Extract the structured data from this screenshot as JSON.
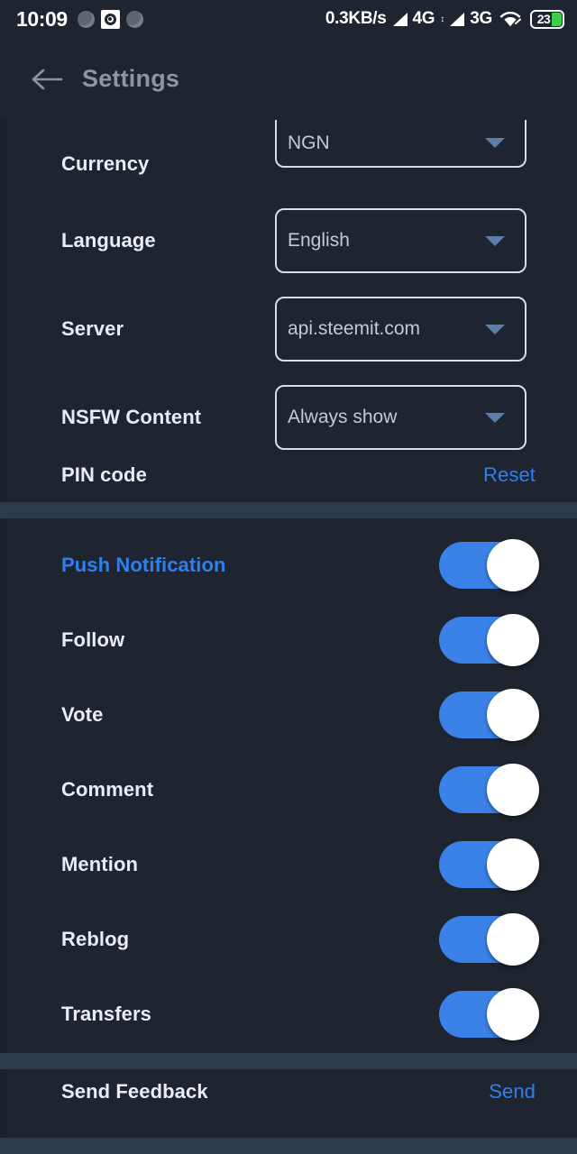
{
  "status_bar": {
    "clock": "10:09",
    "network_speed": "0.3KB/s",
    "network_4g": "4G",
    "network_3g": "3G",
    "updown_glyph": "↕",
    "battery_level": "23",
    "icons": [
      "notification-dot-icon",
      "camera-target-icon",
      "notification-dot-icon",
      "signal-4g-icon",
      "signal-3g-icon",
      "wifi-icon",
      "battery-icon"
    ]
  },
  "header": {
    "back_icon": "arrow-left-icon",
    "title": "Settings"
  },
  "settings": {
    "selects": [
      {
        "label": "Currency",
        "value": "NGN",
        "name": "currency"
      },
      {
        "label": "Language",
        "value": "English",
        "name": "language"
      },
      {
        "label": "Server",
        "value": "api.steemit.com",
        "name": "server"
      },
      {
        "label": "NSFW Content",
        "value": "Always show",
        "name": "nsfw-content"
      }
    ],
    "pin": {
      "label": "PIN code",
      "action": "Reset"
    },
    "toggles": [
      {
        "label": "Push Notification",
        "on": true,
        "accent": true,
        "name": "push-notification"
      },
      {
        "label": "Follow",
        "on": true,
        "accent": false,
        "name": "follow"
      },
      {
        "label": "Vote",
        "on": true,
        "accent": false,
        "name": "vote"
      },
      {
        "label": "Comment",
        "on": true,
        "accent": false,
        "name": "comment"
      },
      {
        "label": "Mention",
        "on": true,
        "accent": false,
        "name": "mention"
      },
      {
        "label": "Reblog",
        "on": true,
        "accent": false,
        "name": "reblog"
      },
      {
        "label": "Transfers",
        "on": true,
        "accent": false,
        "name": "transfers"
      }
    ],
    "feedback": {
      "label": "Send Feedback",
      "action": "Send"
    }
  },
  "colors": {
    "background": "#1e2530",
    "divider": "#2e3a4e",
    "accent_blue": "#2f80ed",
    "toggle_on": "#3b82e8",
    "label": "#e9edf2",
    "value": "#c2cad4",
    "header_title": "#8d959f",
    "battery_green": "#3ccf4e"
  }
}
